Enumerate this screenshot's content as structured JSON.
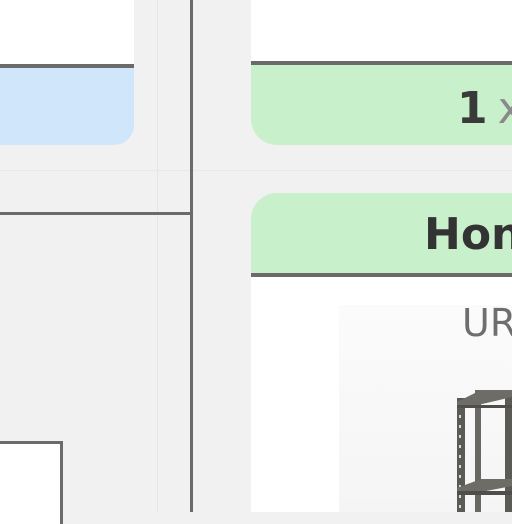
{
  "cart": {
    "quantity": "1",
    "multiplier": "x"
  },
  "product": {
    "header_text": "Hon",
    "label_text": "UR",
    "image_icon": "shelving-unit-image"
  },
  "colors": {
    "blue_bar": "#cfe6fb",
    "green_bar": "#c8f0ca",
    "rule": "#6b6b6b",
    "background": "#f1f1f1"
  }
}
